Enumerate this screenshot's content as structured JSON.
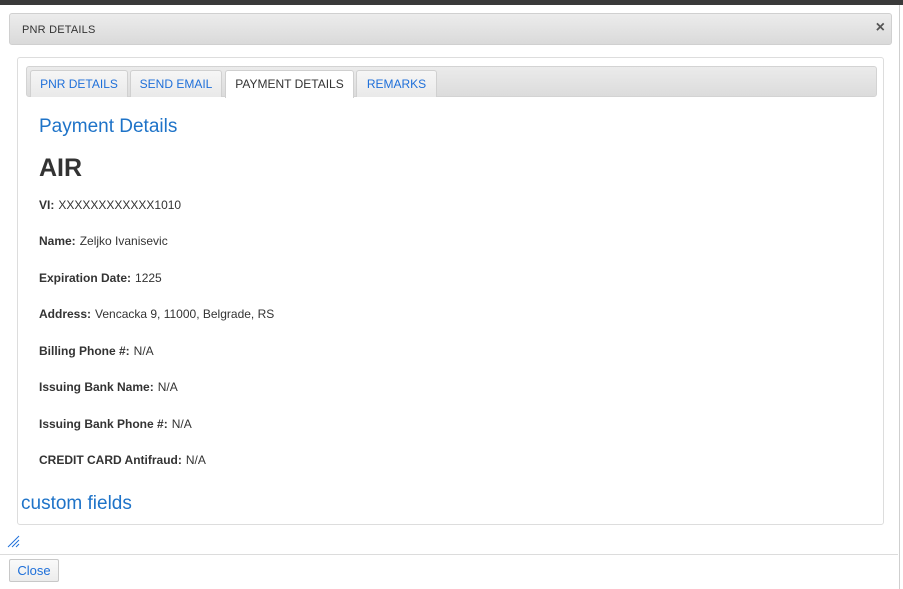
{
  "dialog": {
    "title": "PNR DETAILS",
    "close_icon": "×"
  },
  "tabs": [
    {
      "label": "PNR DETAILS",
      "active": false
    },
    {
      "label": "SEND EMAIL",
      "active": false
    },
    {
      "label": "PAYMENT DETAILS",
      "active": true
    },
    {
      "label": "REMARKS",
      "active": false
    }
  ],
  "payment": {
    "heading": "Payment Details",
    "section": "AIR",
    "fields": [
      {
        "label": "VI:",
        "value": "XXXXXXXXXXXX1010"
      },
      {
        "label": "Name:",
        "value": "Zeljko Ivanisevic"
      },
      {
        "label": "Expiration Date:",
        "value": "1225"
      },
      {
        "label": "Address:",
        "value": "Vencacka 9, 11000, Belgrade, RS"
      },
      {
        "label": "Billing Phone #:",
        "value": "N/A"
      },
      {
        "label": "Issuing Bank Name:",
        "value": "N/A"
      },
      {
        "label": "Issuing Bank Phone #:",
        "value": "N/A"
      },
      {
        "label": "CREDIT CARD Antifraud:",
        "value": "N/A"
      }
    ]
  },
  "custom_fields_heading": "custom fields",
  "footer": {
    "close_label": "Close"
  },
  "colors": {
    "link_blue": "#1e73c8",
    "text": "#333333"
  },
  "icons": {
    "dialog_close": "close-icon",
    "resize": "resize-handle-icon"
  }
}
